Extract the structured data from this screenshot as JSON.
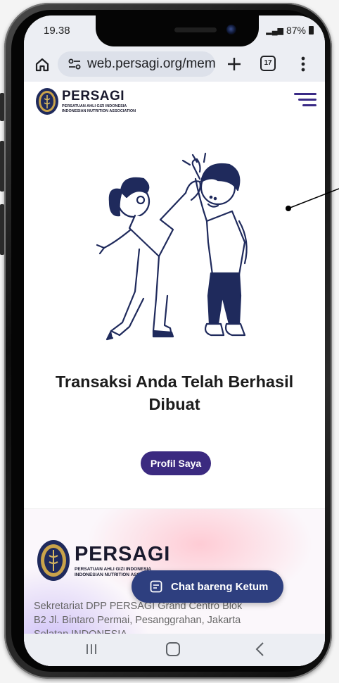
{
  "status_bar": {
    "time": "19.38",
    "battery": "87%"
  },
  "browser": {
    "url": "web.persagi.org/meml",
    "tab_count": "17"
  },
  "site_header": {
    "brand": "PERSAGI",
    "subtitle_line1": "PERSATUAN AHLI GIZI INDONESIA",
    "subtitle_line2": "INDONESIAN NUTRITION ASSOCIATION"
  },
  "hero": {
    "headline": "Transaksi Anda Telah Berhasil Dibuat",
    "cta_label": "Profil Saya"
  },
  "footer": {
    "brand": "PERSAGI",
    "subtitle_line1": "PERSATUAN AHLI GIZI INDONESIA",
    "subtitle_line2": "INDONESIAN NUTRITION ASSOCIATION",
    "address": "Sekretariat DPP PERSAGI Grand Centro Blok B2 Jl. Bintaro Permai, Pesanggrahan, Jakarta Selatan INDONESIA"
  },
  "chat": {
    "label": "Chat bareng Ketum"
  },
  "colors": {
    "primary": "#3b2a80",
    "chat_button": "#2e3f7f",
    "illustration_navy": "#1f2a5c"
  }
}
